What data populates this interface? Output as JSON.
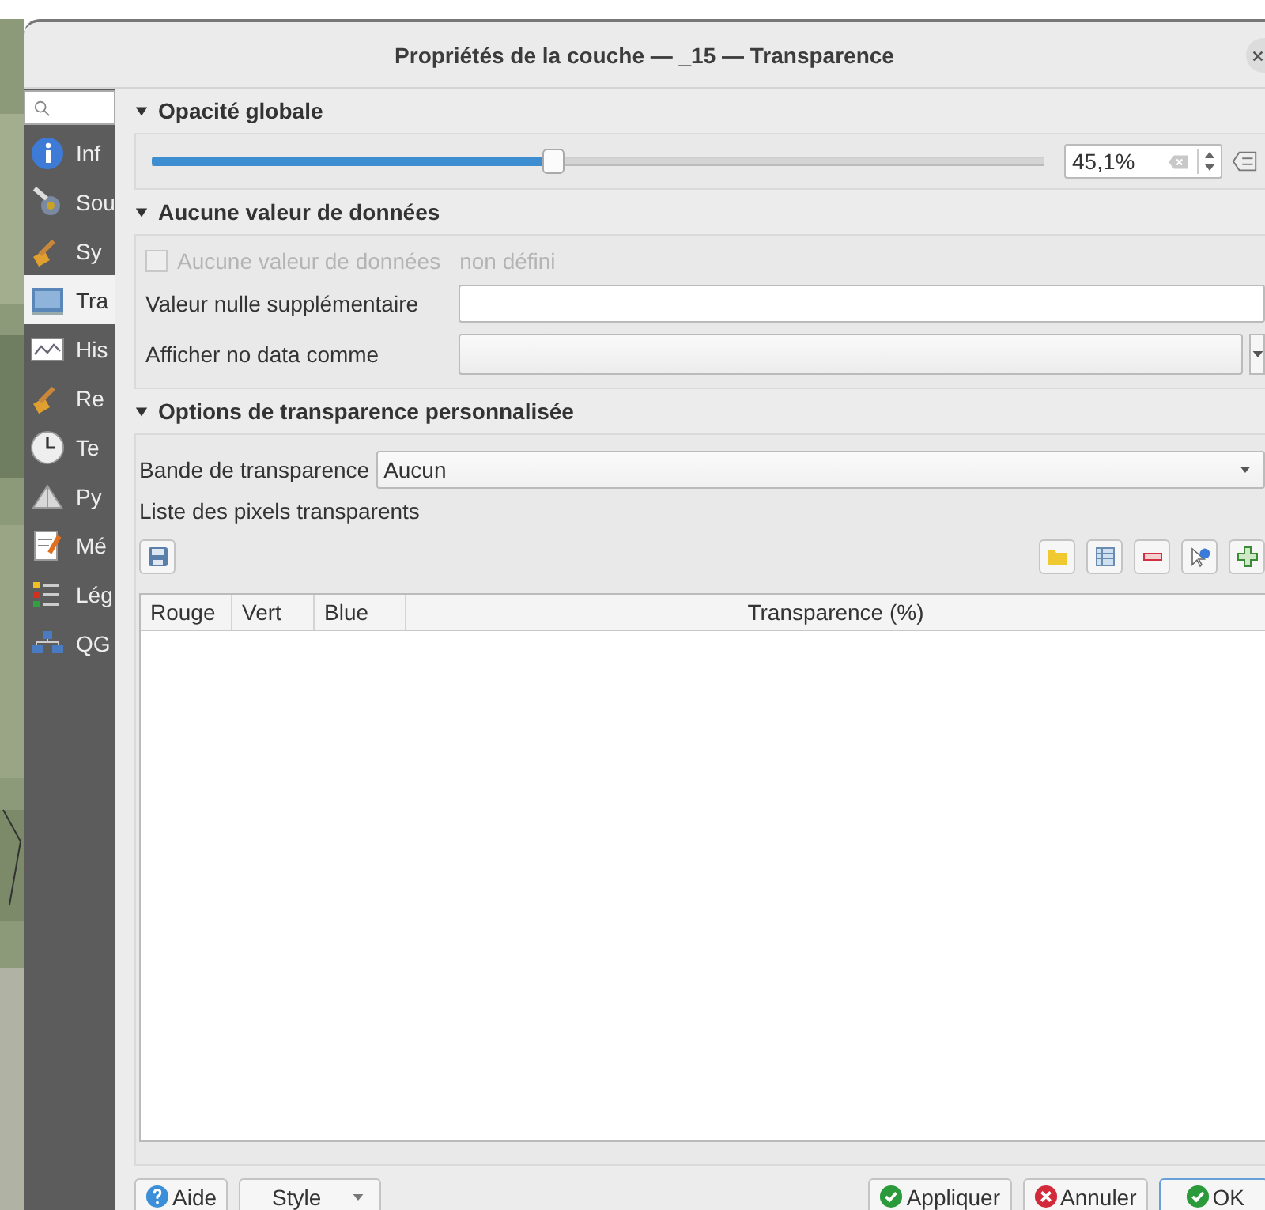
{
  "window": {
    "title": "Propriétés de la couche — _15 — Transparence"
  },
  "sidebar": {
    "items": [
      {
        "label": "Inf",
        "selected": false
      },
      {
        "label": "Sou",
        "selected": false
      },
      {
        "label": "Sy",
        "selected": false
      },
      {
        "label": "Tra",
        "selected": true
      },
      {
        "label": "His",
        "selected": false
      },
      {
        "label": "Re",
        "selected": false
      },
      {
        "label": "Te",
        "selected": false
      },
      {
        "label": "Py",
        "selected": false
      },
      {
        "label": "Mé",
        "selected": false
      },
      {
        "label": "Lég",
        "selected": false
      },
      {
        "label": "QG",
        "selected": false
      }
    ]
  },
  "opacity": {
    "title": "Opacité globale",
    "expanded": true,
    "level": 0.451,
    "value": "45,1%"
  },
  "no_data": {
    "title": "Aucune valeur de données",
    "expanded": true,
    "checkbox": {
      "label": "Aucune valeur de données",
      "checked": false,
      "disabled": true
    },
    "status": "non défini",
    "extra_null_label": "Valeur nulle supplémentaire",
    "display_as_label": "Afficher no data comme"
  },
  "transparency": {
    "title": "Options de transparence personnalisée",
    "expanded": true,
    "band_label": "Bande de transparence",
    "band_value": "Aucun",
    "list_label": "Liste des pixels transparents",
    "columns": [
      "Rouge",
      "Vert",
      "Blue",
      "Transparence (%)"
    ]
  },
  "buttons": [
    {
      "label": "Aide",
      "kind": "help"
    },
    {
      "label": "Style",
      "kind": "menu"
    },
    {
      "label": "Appliquer",
      "kind": "apply"
    },
    {
      "label": "Annuler",
      "kind": "cancel"
    },
    {
      "label": "OK",
      "kind": "ok"
    }
  ]
}
